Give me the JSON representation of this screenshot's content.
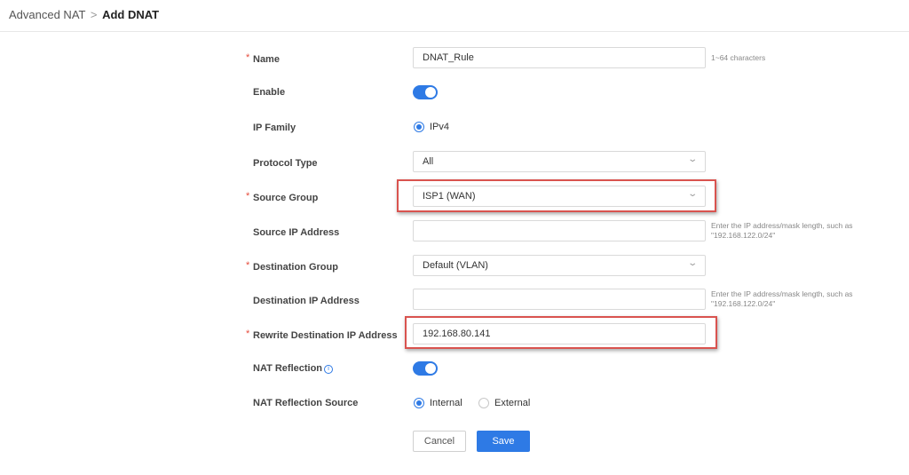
{
  "breadcrumb": {
    "parent": "Advanced NAT",
    "separator": ">",
    "current": "Add DNAT"
  },
  "form": {
    "name": {
      "label": "Name",
      "required": "*",
      "value": "DNAT_Rule",
      "hint": "1~64 characters"
    },
    "enable": {
      "label": "Enable",
      "value": true
    },
    "ip_family": {
      "label": "IP Family",
      "option": "IPv4"
    },
    "protocol_type": {
      "label": "Protocol Type",
      "value": "All"
    },
    "source_group": {
      "label": "Source Group",
      "required": "*",
      "value": "ISP1 (WAN)"
    },
    "source_ip": {
      "label": "Source IP Address",
      "value": "",
      "hint": "Enter the IP address/mask length, such as \"192.168.122.0/24\""
    },
    "destination_group": {
      "label": "Destination Group",
      "required": "*",
      "value": "Default (VLAN)"
    },
    "destination_ip": {
      "label": "Destination IP Address",
      "value": "",
      "hint": "Enter the IP address/mask length, such as \"192.168.122.0/24\""
    },
    "rewrite_destination_ip": {
      "label": "Rewrite Destination IP Address",
      "required": "*",
      "value": "192.168.80.141"
    },
    "nat_reflection": {
      "label": "NAT Reflection",
      "value": true,
      "info_icon": "info-icon"
    },
    "nat_reflection_source": {
      "label": "NAT Reflection Source",
      "options": [
        "Internal",
        "External"
      ],
      "selected": "Internal"
    }
  },
  "buttons": {
    "cancel": "Cancel",
    "save": "Save"
  },
  "icons": {
    "dropdown": "chevron-down-icon",
    "info": "info-icon"
  },
  "colors": {
    "accent": "#2e7ae5",
    "required": "#e64c3c",
    "highlight": "#d9534f"
  }
}
